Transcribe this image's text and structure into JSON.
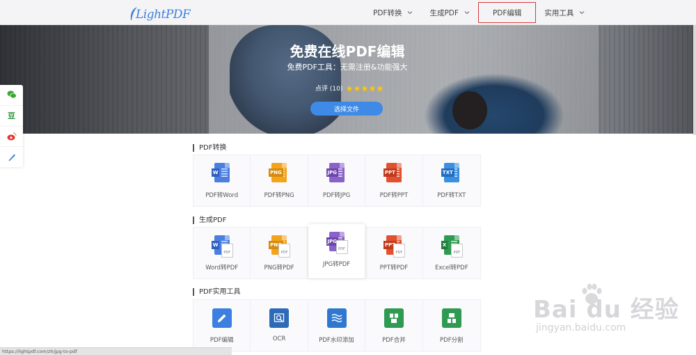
{
  "header": {
    "logo_text": "LightPDF",
    "nav": [
      {
        "label": "PDF转换",
        "has_dropdown": true
      },
      {
        "label": "生成PDF",
        "has_dropdown": true
      },
      {
        "label": "PDF编辑",
        "has_dropdown": false,
        "highlighted": true
      },
      {
        "label": "实用工具",
        "has_dropdown": true
      }
    ]
  },
  "hero": {
    "title": "免费在线PDF编辑",
    "subtitle": "免费PDF工具：无需注册&功能强大",
    "rating_label": "点评 (10)",
    "rating_stars": 5,
    "button_label": "选择文件"
  },
  "share_bar": [
    "wechat-icon",
    "douban-icon",
    "weibo-icon",
    "pen-icon"
  ],
  "share_douban_glyph": "豆",
  "sections": [
    {
      "title": "PDF转换",
      "tiles": [
        {
          "label": "PDF转Word",
          "tag": "W",
          "color": "#4a7fe0"
        },
        {
          "label": "PDF转PNG",
          "tag": "PNG",
          "color": "#f2a51c"
        },
        {
          "label": "PDF转JPG",
          "tag": "JPG",
          "color": "#8a62c8"
        },
        {
          "label": "PDF转PPT",
          "tag": "PPT",
          "color": "#e0512f"
        },
        {
          "label": "PDF转TXT",
          "tag": "TXT",
          "color": "#3a8fe0"
        }
      ]
    },
    {
      "title": "生成PDF",
      "tiles": [
        {
          "label": "Word转PDF",
          "tag": "W",
          "color": "#4a7fe0"
        },
        {
          "label": "PNG转PDF",
          "tag": "PNG",
          "color": "#f2a51c"
        },
        {
          "label": "JPG转PDF",
          "tag": "JPG",
          "color": "#8a62c8"
        },
        {
          "label": "PPT转PDF",
          "tag": "PPT",
          "color": "#e0512f"
        },
        {
          "label": "Excel转PDF",
          "tag": "X",
          "color": "#2e9a52"
        }
      ]
    },
    {
      "title": "PDF实用工具",
      "tiles": [
        {
          "label": "PDF编辑",
          "icon": "edit-icon",
          "color": "#3d7fe0"
        },
        {
          "label": "OCR",
          "icon": "ocr-icon",
          "color": "#2d6ab8"
        },
        {
          "label": "PDF水印添加",
          "icon": "watermark-icon",
          "color": "#2f78d0"
        },
        {
          "label": "PDF合并",
          "icon": "merge-icon",
          "color": "#2e9a52"
        },
        {
          "label": "PDF分割",
          "icon": "split-icon",
          "color": "#2e9a52"
        }
      ]
    }
  ],
  "pdf_badge_text": "PDF",
  "status_url": "https://lightpdf.com/zh/jpg-to-pdf",
  "watermark": {
    "main": "Bai du 经验",
    "url": "jingyan.baidu.com"
  }
}
